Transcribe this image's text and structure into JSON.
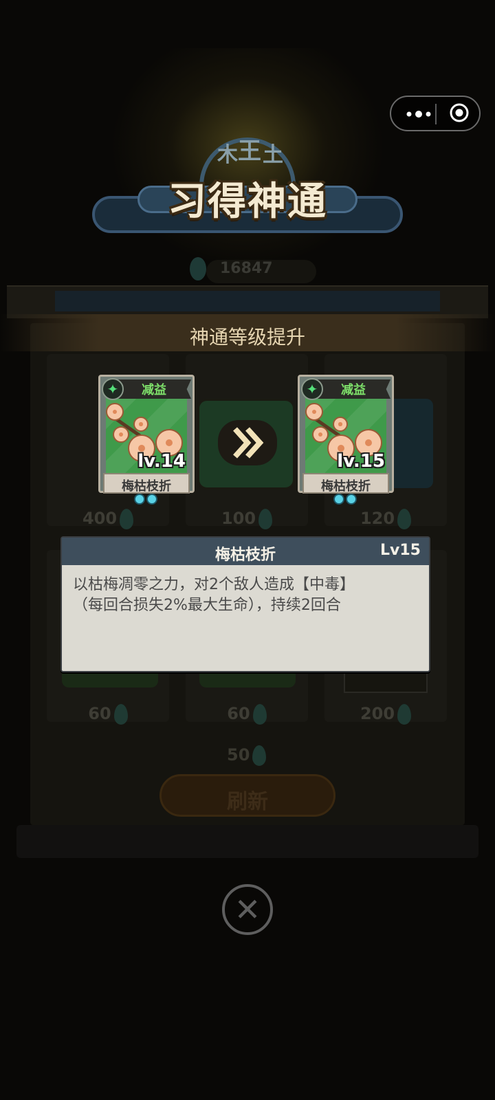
{
  "title": "习得神通",
  "coins": "16847",
  "level_up_header": "神通等级提升",
  "card_before": {
    "tag": "减益",
    "level": "lv.14",
    "name": "梅枯枝折",
    "pips": 2
  },
  "card_after": {
    "tag": "减益",
    "level": "lv.15",
    "name": "梅枯枝折",
    "pips": 2
  },
  "tooltip": {
    "title": "梅枯枝折",
    "level": "Lv15",
    "description_line1": "以枯梅凋零之力，对2个敌人造成【中毒】",
    "description_line2": "（每回合损失2%最大生命），持续2回合"
  },
  "background_costs": [
    "400",
    "100",
    "120",
    "60",
    "60",
    "200"
  ],
  "refresh_cost": "50",
  "refresh_label": "刷新",
  "icons": {
    "capsule_menu": "more-dots-icon",
    "capsule_close": "target-circle-icon",
    "arrow": "double-chevron-right-icon",
    "close": "close-circle-icon",
    "card_badge": "sparkle-star-icon",
    "gem": "jade-gem-icon"
  },
  "colors": {
    "accent": "#7ee06a",
    "tooltip_header": "#3e4e5c",
    "pip": "#5ad2e6"
  }
}
